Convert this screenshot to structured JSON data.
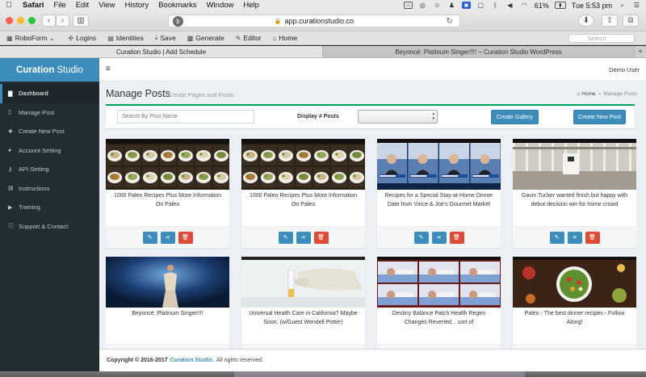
{
  "menubar": {
    "app": "Safari",
    "items": [
      "File",
      "Edit",
      "View",
      "History",
      "Bookmarks",
      "Window",
      "Help"
    ],
    "battery": "61%",
    "clock": "Tue 5:53 pm"
  },
  "browser": {
    "url": "app.curationstudio.co",
    "bookmarks": [
      "RoboForm",
      "Logins",
      "Identities",
      "Save",
      "Generate",
      "Editor",
      "Home"
    ],
    "search_placeholder": "Search",
    "tabs": [
      "Curation Studio | Add Schedule",
      "Beyoncé: Platinum Singer!!!! – Curation Studio WordPress"
    ]
  },
  "app": {
    "logo_bold": "Curation",
    "logo_light": "Studio",
    "user": "Demo User",
    "sidebar": [
      {
        "label": "Dashboard",
        "icon": "dashboard-icon",
        "glyph": "▇"
      },
      {
        "label": "Manage Post",
        "icon": "file-icon",
        "glyph": "▯"
      },
      {
        "label": "Create New Post",
        "icon": "plus-icon",
        "glyph": "✚"
      },
      {
        "label": "Account Setting",
        "icon": "user-icon",
        "glyph": "●"
      },
      {
        "label": "API Setting",
        "icon": "key-icon",
        "glyph": "⚷"
      },
      {
        "label": "Instructions",
        "icon": "book-icon",
        "glyph": "▤"
      },
      {
        "label": "Training",
        "icon": "video-icon",
        "glyph": "▶"
      },
      {
        "label": "Support & Contact",
        "icon": "info-icon",
        "glyph": "ⓘ"
      }
    ]
  },
  "page": {
    "title": "Manage Posts",
    "subtitle": "Create Pages and Posts",
    "breadcrumb_home": "Home",
    "breadcrumb_current": "Manage Posts",
    "search_placeholder": "Search By Post Name",
    "display_label": "Display # Posts",
    "create_gallery": "Create Gallery",
    "create_new_post": "Create New Post"
  },
  "posts": [
    {
      "title": "1000 Paleo Recipes Plus More Information On Paleo",
      "image": "food-collage"
    },
    {
      "title": "1000 Paleo Recipes Plus More Information On Paleo",
      "image": "food-collage"
    },
    {
      "title": "Recipes for a Special Stay-at-Home Dinner Date from Vince & Joe's Gourmet Market",
      "image": "news-anchors"
    },
    {
      "title": "Gavin Tucker wanted finish but happy with debut decision win for home crowd",
      "image": "shop-interior"
    },
    {
      "title": "Beyoncé: Platinum Singer!!!!",
      "image": "stage-performer"
    },
    {
      "title": "Universal Health Care in California? Maybe Soon. (w/Guest Wendell Potter)",
      "image": "lab-glove"
    },
    {
      "title": "Destiny Balance Patch Health Regen Changes Reverted... sort of",
      "image": "sleeping-collage"
    },
    {
      "title": "Paleo - The best dinner recipes - Follow Along!",
      "image": "salad-table"
    }
  ],
  "footer": {
    "copyright": "Copyright © 2016-2017",
    "brand": "Curation Studio.",
    "rights": "All rights reserved."
  }
}
